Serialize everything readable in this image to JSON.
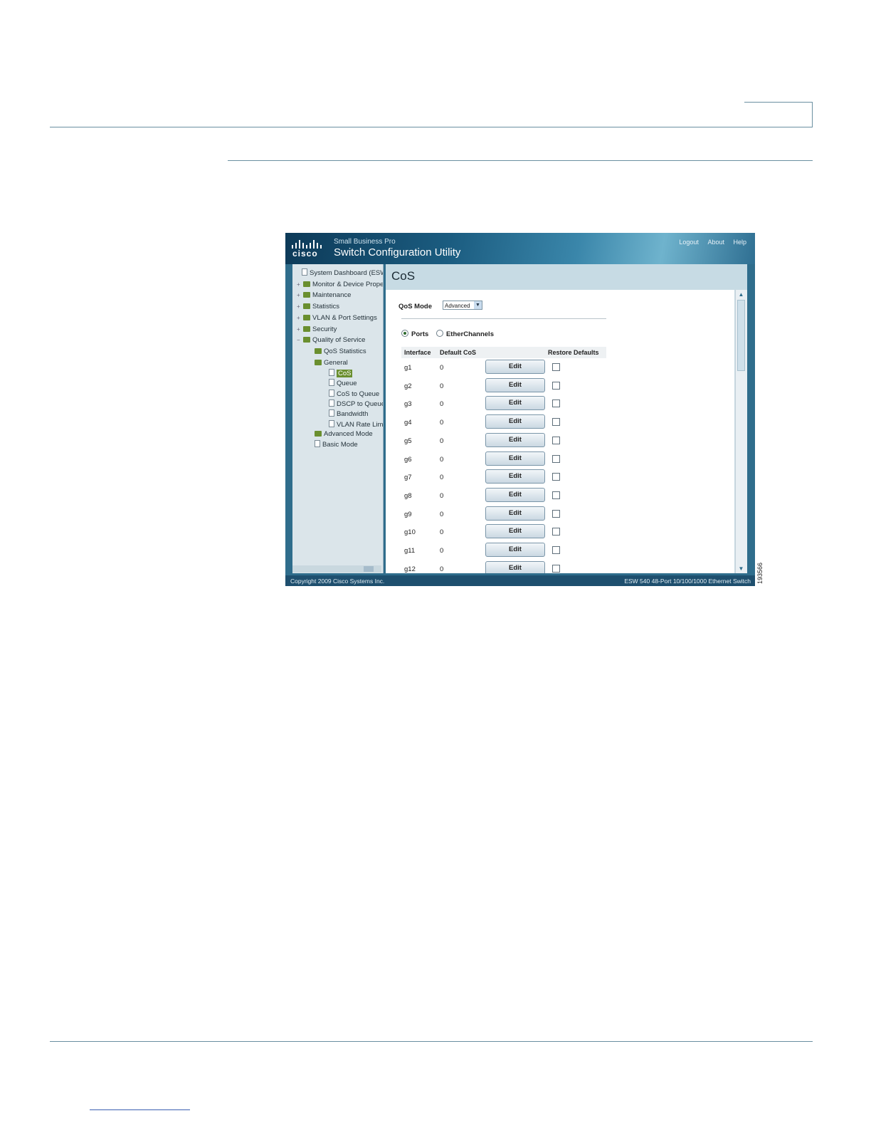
{
  "app": {
    "brand": "cisco",
    "product_line": "Small Business Pro",
    "product_name": "Switch Configuration Utility",
    "links": [
      "Logout",
      "About",
      "Help"
    ]
  },
  "nav": {
    "items": [
      {
        "label": "System Dashboard (ESW-",
        "type": "page",
        "expander": ""
      },
      {
        "label": "Monitor & Device Prope",
        "type": "folder",
        "expander": "+"
      },
      {
        "label": "Maintenance",
        "type": "folder",
        "expander": "+"
      },
      {
        "label": "Statistics",
        "type": "folder",
        "expander": "+"
      },
      {
        "label": "VLAN & Port Settings",
        "type": "folder",
        "expander": "+"
      },
      {
        "label": "Security",
        "type": "folder",
        "expander": "+"
      },
      {
        "label": "Quality of Service",
        "type": "folder",
        "expander": "−"
      },
      {
        "label": "QoS Statistics",
        "type": "folder",
        "expander": ""
      },
      {
        "label": "General",
        "type": "folder",
        "expander": ""
      },
      {
        "label": "CoS",
        "type": "page",
        "expander": "",
        "selected": true
      },
      {
        "label": "Queue",
        "type": "page",
        "expander": ""
      },
      {
        "label": "CoS to Queue",
        "type": "page",
        "expander": ""
      },
      {
        "label": "DSCP to Queue",
        "type": "page",
        "expander": ""
      },
      {
        "label": "Bandwidth",
        "type": "page",
        "expander": ""
      },
      {
        "label": "VLAN Rate Limi",
        "type": "page",
        "expander": ""
      },
      {
        "label": "Advanced Mode",
        "type": "folder",
        "expander": ""
      },
      {
        "label": "Basic Mode",
        "type": "page",
        "expander": ""
      }
    ]
  },
  "page": {
    "title": "CoS",
    "qos_mode_label": "QoS Mode",
    "qos_mode_value": "Advanced",
    "radio_ports": "Ports",
    "radio_etherchannels": "EtherChannels",
    "selected_radio": "Ports"
  },
  "table": {
    "headers": [
      "Interface",
      "Default CoS",
      "",
      "Restore Defaults"
    ],
    "edit_label": "Edit",
    "rows": [
      {
        "interface": "g1",
        "cos": "0"
      },
      {
        "interface": "g2",
        "cos": "0"
      },
      {
        "interface": "g3",
        "cos": "0"
      },
      {
        "interface": "g4",
        "cos": "0"
      },
      {
        "interface": "g5",
        "cos": "0"
      },
      {
        "interface": "g6",
        "cos": "0"
      },
      {
        "interface": "g7",
        "cos": "0"
      },
      {
        "interface": "g8",
        "cos": "0"
      },
      {
        "interface": "g9",
        "cos": "0"
      },
      {
        "interface": "g10",
        "cos": "0"
      },
      {
        "interface": "g11",
        "cos": "0"
      },
      {
        "interface": "g12",
        "cos": "0"
      }
    ]
  },
  "status": {
    "copyright": "Copyright 2009 Cisco Systems Inc.",
    "device": "ESW 540 48-Port 10/100/1000 Ethernet Switch"
  },
  "figure_number": "193566",
  "colors": {
    "banner": "#1b5c80",
    "selected": "#6a8f2f",
    "status_bar": "#1e4f6e"
  }
}
